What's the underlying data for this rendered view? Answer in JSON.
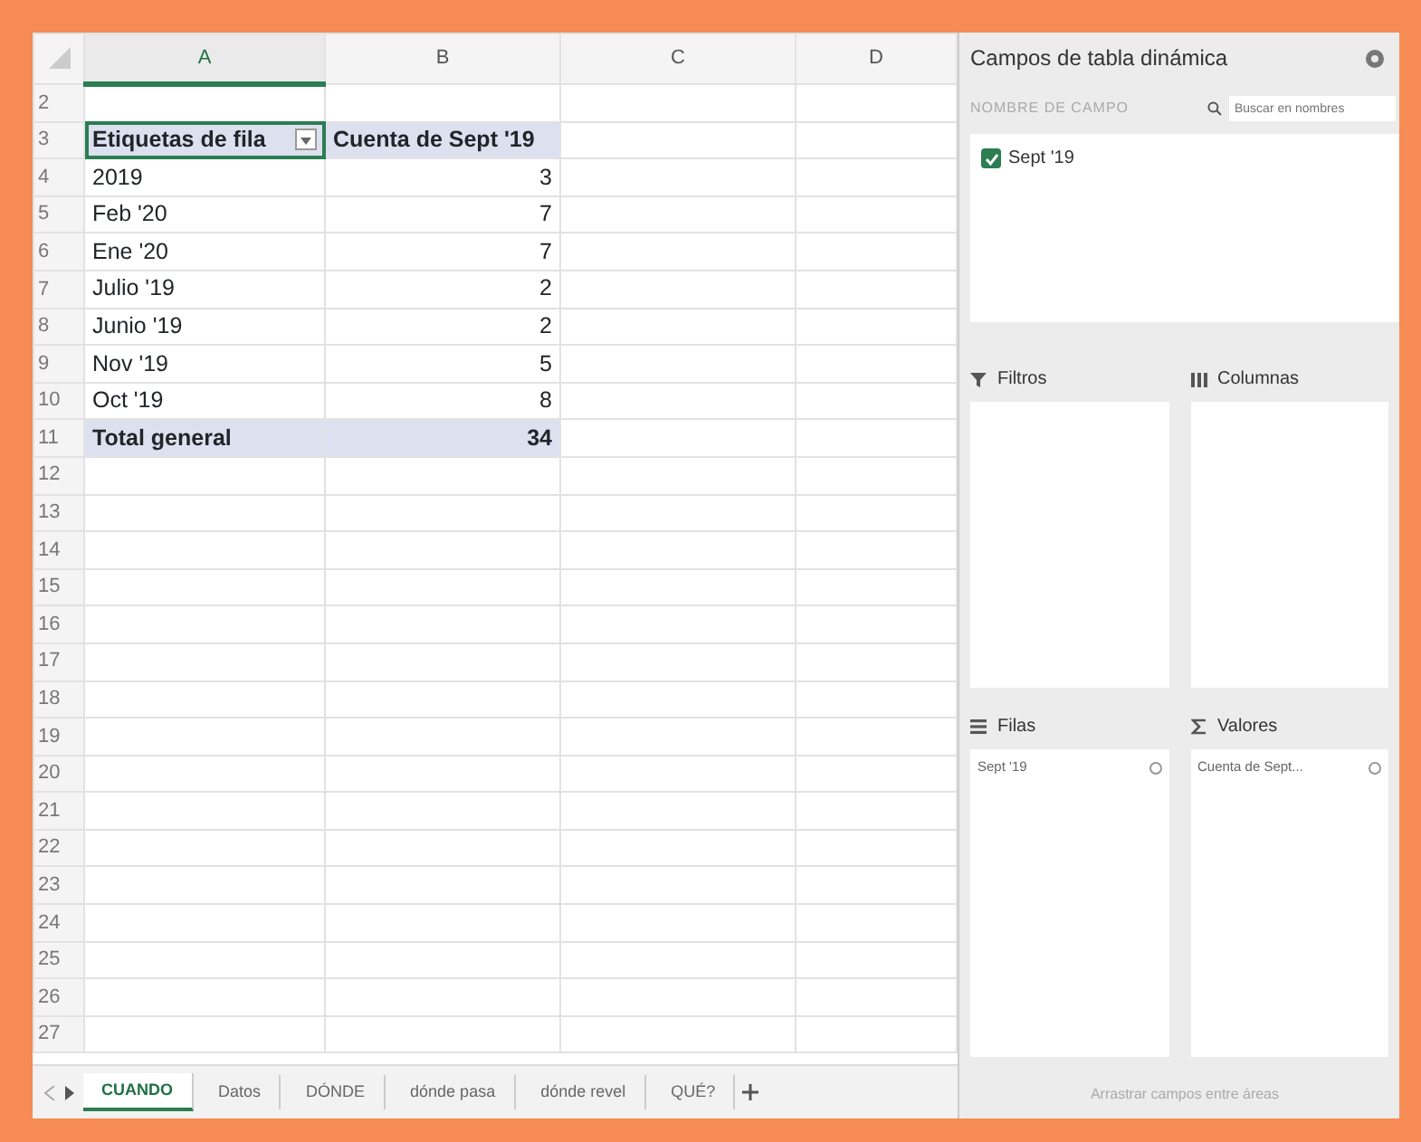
{
  "sheet": {
    "columns": [
      {
        "label": "A",
        "selected": true
      },
      {
        "label": "B",
        "selected": false
      },
      {
        "label": "C",
        "selected": false
      },
      {
        "label": "D",
        "selected": false
      }
    ],
    "rows": [
      {
        "number": "2",
        "kind": "empty"
      },
      {
        "number": "3",
        "kind": "header",
        "label": "Etiquetas de fila",
        "value": "Cuenta de Sept '19"
      },
      {
        "number": "4",
        "kind": "item",
        "label": "2019",
        "value": "3"
      },
      {
        "number": "5",
        "kind": "item",
        "label": "Feb '20",
        "value": "7"
      },
      {
        "number": "6",
        "kind": "item",
        "label": "Ene '20",
        "value": "7"
      },
      {
        "number": "7",
        "kind": "item",
        "label": "Julio '19",
        "value": "2"
      },
      {
        "number": "8",
        "kind": "item",
        "label": "Junio '19",
        "value": "2"
      },
      {
        "number": "9",
        "kind": "item",
        "label": "Nov '19",
        "value": "5"
      },
      {
        "number": "10",
        "kind": "item",
        "label": "Oct '19",
        "value": "8"
      },
      {
        "number": "11",
        "kind": "total",
        "label": "Total general",
        "value": "34"
      },
      {
        "number": "12",
        "kind": "empty"
      },
      {
        "number": "13",
        "kind": "empty"
      },
      {
        "number": "14",
        "kind": "empty"
      },
      {
        "number": "15",
        "kind": "empty"
      },
      {
        "number": "16",
        "kind": "empty"
      },
      {
        "number": "17",
        "kind": "empty"
      },
      {
        "number": "18",
        "kind": "empty"
      },
      {
        "number": "19",
        "kind": "empty"
      },
      {
        "number": "20",
        "kind": "empty"
      },
      {
        "number": "21",
        "kind": "empty"
      },
      {
        "number": "22",
        "kind": "empty"
      },
      {
        "number": "23",
        "kind": "empty"
      },
      {
        "number": "24",
        "kind": "empty"
      },
      {
        "number": "25",
        "kind": "empty"
      },
      {
        "number": "26",
        "kind": "empty"
      },
      {
        "number": "27",
        "kind": "empty"
      }
    ]
  },
  "sheet_tabs": [
    {
      "label": "CUANDO",
      "selected": true
    },
    {
      "label": "Datos",
      "selected": false
    },
    {
      "label": "DÓNDE",
      "selected": false
    },
    {
      "label": "dónde pasa",
      "selected": false
    },
    {
      "label": "dónde revel",
      "selected": false
    },
    {
      "label": "QUÉ?",
      "selected": false
    }
  ],
  "pivot_panel": {
    "title": "Campos de tabla dinámica",
    "field_header": "NOMBRE DE CAMPO",
    "search": {
      "placeholder": "Buscar en nombres"
    },
    "fields": [
      {
        "label": "Sept '19",
        "checked": true
      }
    ],
    "areas": [
      {
        "kind": "filters",
        "label": "Filtros"
      },
      {
        "kind": "columns",
        "label": "Columnas"
      },
      {
        "kind": "rows",
        "label": "Filas",
        "items": [
          "Sept '19"
        ]
      },
      {
        "kind": "values",
        "label": "Valores",
        "items": [
          "Cuenta de Sept..."
        ]
      }
    ],
    "footer": "Arrastrar campos entre áreas"
  }
}
